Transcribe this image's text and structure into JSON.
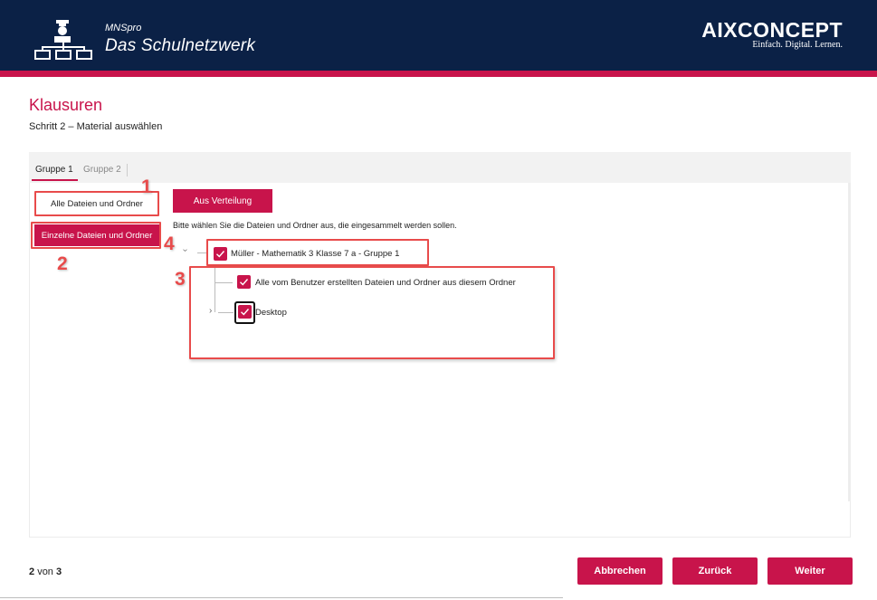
{
  "header": {
    "brand_small": "MNSpro",
    "brand_big": "Das Schulnetzwerk",
    "company": "AIXCONCEPT",
    "tagline": "Einfach. Digital. Lernen.",
    "logo_icon": "network-teacher-icon"
  },
  "page": {
    "title": "Klausuren",
    "subtitle": "Schritt 2 – Material auswählen"
  },
  "tabs": [
    {
      "label": "Gruppe 1",
      "active": true
    },
    {
      "label": "Gruppe 2",
      "active": false
    }
  ],
  "mode_buttons": {
    "all_files": "Alle Dateien und Ordner",
    "single_files": "Einzelne Dateien und Ordner"
  },
  "distribution_button": "Aus Verteilung",
  "instruction": "Bitte wählen Sie die Dateien und Ordner aus, die eingesammelt werden sollen.",
  "tree": {
    "root": {
      "label": "Müller - Mathematik 3 Klasse 7 a - Gruppe 1",
      "checked": true
    },
    "children": [
      {
        "label": "Alle vom Benutzer erstellten Dateien und Ordner aus diesem Ordner",
        "checked": true
      },
      {
        "label": "Desktop",
        "checked": true
      }
    ]
  },
  "annotations": [
    "1",
    "2",
    "3",
    "4"
  ],
  "footer": {
    "step_current": "2",
    "step_sep": "von",
    "step_total": "3",
    "cancel": "Abbrechen",
    "back": "Zurück",
    "next": "Weiter"
  },
  "colors": {
    "accent": "#c8144b",
    "header_bg": "#0b2146",
    "annotation": "#e84b4b"
  }
}
